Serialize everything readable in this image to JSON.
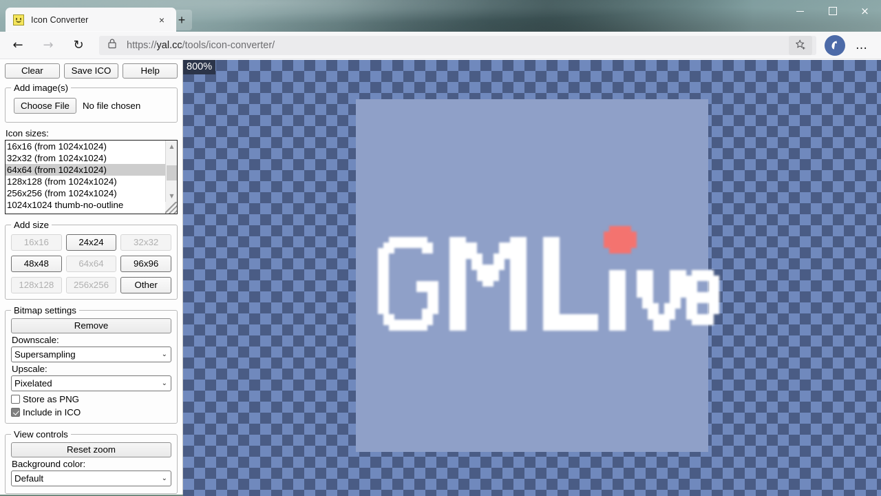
{
  "browser": {
    "tab": {
      "title": "Icon Converter",
      "favicon": "smiley-yellow-icon",
      "close_label": "×"
    },
    "newtab_label": "+",
    "window_controls": {
      "minimize": "—",
      "maximize": "□",
      "close": "×"
    },
    "nav": {
      "back": "←",
      "forward": "→",
      "reload": "↻"
    },
    "address": {
      "lock_icon": "lock-icon",
      "url_scheme": "https://",
      "url_host": "yal.cc",
      "url_path": "/tools/icon-converter/",
      "url_full": "https://yal.cc/tools/icon-converter/"
    },
    "star_icon": "star-add-icon",
    "profile_icon": "profile-avatar-icon",
    "more_label": "…"
  },
  "sidebar": {
    "top_buttons": [
      {
        "label": "Clear",
        "name": "clear-button"
      },
      {
        "label": "Save ICO",
        "name": "save-ico-button"
      },
      {
        "label": "Help",
        "name": "help-button"
      }
    ],
    "add_images": {
      "legend": "Add image(s)",
      "choose_file_label": "Choose File",
      "file_status": "No file chosen"
    },
    "icon_sizes": {
      "label": "Icon sizes:",
      "items": [
        {
          "label": "16x16 (from 1024x1024)",
          "selected": false
        },
        {
          "label": "32x32 (from 1024x1024)",
          "selected": false
        },
        {
          "label": "64x64 (from 1024x1024)",
          "selected": true
        },
        {
          "label": "128x128 (from 1024x1024)",
          "selected": false
        },
        {
          "label": "256x256 (from 1024x1024)",
          "selected": false
        },
        {
          "label": "1024x1024 thumb-no-outline",
          "selected": false
        }
      ],
      "scroll_up": "▲",
      "scroll_down": "▼"
    },
    "add_size": {
      "legend": "Add size",
      "buttons": [
        {
          "label": "16x16",
          "disabled": true
        },
        {
          "label": "24x24",
          "disabled": false
        },
        {
          "label": "32x32",
          "disabled": true
        },
        {
          "label": "48x48",
          "disabled": false
        },
        {
          "label": "64x64",
          "disabled": true
        },
        {
          "label": "96x96",
          "disabled": false
        },
        {
          "label": "128x128",
          "disabled": true
        },
        {
          "label": "256x256",
          "disabled": true
        },
        {
          "label": "Other",
          "disabled": false
        }
      ]
    },
    "bitmap_settings": {
      "legend": "Bitmap settings",
      "remove_label": "Remove",
      "downscale_label": "Downscale:",
      "downscale_value": "Supersampling",
      "upscale_label": "Upscale:",
      "upscale_value": "Pixelated",
      "store_png_label": "Store as PNG",
      "store_png_checked": false,
      "include_ico_label": "Include in ICO",
      "include_ico_checked": true,
      "select_arrow": "⌄"
    },
    "view_controls": {
      "legend": "View controls",
      "reset_zoom_label": "Reset zoom",
      "background_color_label": "Background color:",
      "background_color_value": "Default",
      "select_arrow": "⌄"
    }
  },
  "canvas": {
    "zoom_level": "800%",
    "checker_dark": "#4a5c85",
    "checker_light": "#7089bd",
    "image_background": "#8fa0c8",
    "logo_text": "GMLive",
    "logo_color": "#ffffff",
    "accent_dot_color": "#f4736f",
    "pixel_scale": 8,
    "source_size": 64,
    "rendered_size": 512
  }
}
